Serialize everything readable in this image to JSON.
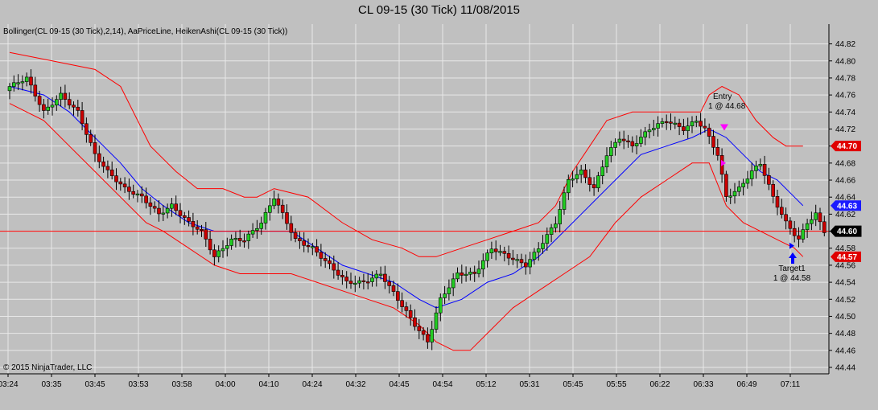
{
  "chart_data": {
    "type": "candlestick",
    "title": "CL 09-15 (30 Tick)  11/08/2015",
    "indicator_caption": "Bollinger(CL 09-15 (30 Tick),2,14), AaPriceLine, HeikenAshi(CL 09-15 (30 Tick))",
    "copyright": "© 2015 NinjaTrader, LLC",
    "ylim": [
      44.44,
      44.83
    ],
    "y_ticks": [
      "44.82",
      "44.80",
      "44.78",
      "44.76",
      "44.74",
      "44.72",
      "44.70",
      "44.68",
      "44.66",
      "44.64",
      "44.62",
      "44.60",
      "44.58",
      "44.56",
      "44.54",
      "44.52",
      "44.50",
      "44.48",
      "44.46",
      "44.44"
    ],
    "x_ticks": [
      "03:24",
      "03:35",
      "03:45",
      "03:53",
      "03:58",
      "04:00",
      "04:10",
      "04:24",
      "04:32",
      "04:45",
      "04:54",
      "05:12",
      "05:31",
      "05:45",
      "05:55",
      "06:22",
      "06:33",
      "06:49",
      "07:11"
    ],
    "price_line": 44.6,
    "price_tags": [
      {
        "label": "44.70",
        "value": 44.7,
        "color": "#e00000"
      },
      {
        "label": "44.63",
        "value": 44.63,
        "color": "#1a1aff"
      },
      {
        "label": "44.60",
        "value": 44.6,
        "color": "#000000"
      },
      {
        "label": "44.57",
        "value": 44.57,
        "color": "#e00000"
      }
    ],
    "annotations": [
      {
        "name": "entry",
        "line1": "Entry",
        "line2": "1 @ 44.68"
      },
      {
        "name": "target",
        "line1": "Target1",
        "line2": "1 @ 44.58"
      }
    ],
    "colors": {
      "bullish": "#22cc22",
      "bearish": "#cc0000",
      "upper_band": "#ff0000",
      "lower_band": "#ff0000",
      "middle_band": "#0000ff",
      "price_line": "#ff0000",
      "entry_marker": "#ff00ff",
      "target_marker": "#0000ff",
      "grid": "#e8e8e8"
    },
    "close_path": [
      [
        0,
        44.77
      ],
      [
        4,
        44.78
      ],
      [
        8,
        44.74
      ],
      [
        12,
        44.76
      ],
      [
        16,
        44.74
      ],
      [
        20,
        44.69
      ],
      [
        23,
        44.67
      ],
      [
        27,
        44.65
      ],
      [
        31,
        44.64
      ],
      [
        35,
        44.62
      ],
      [
        38,
        44.63
      ],
      [
        42,
        44.61
      ],
      [
        45,
        44.6
      ],
      [
        48,
        44.57
      ],
      [
        52,
        44.59
      ],
      [
        55,
        44.59
      ],
      [
        59,
        44.61
      ],
      [
        62,
        44.64
      ],
      [
        64,
        44.62
      ],
      [
        67,
        44.59
      ],
      [
        71,
        44.58
      ],
      [
        75,
        44.56
      ],
      [
        79,
        44.54
      ],
      [
        83,
        44.54
      ],
      [
        87,
        44.55
      ],
      [
        91,
        44.52
      ],
      [
        95,
        44.49
      ],
      [
        98,
        44.47
      ],
      [
        101,
        44.52
      ],
      [
        105,
        44.55
      ],
      [
        109,
        44.55
      ],
      [
        113,
        44.58
      ],
      [
        117,
        44.57
      ],
      [
        121,
        44.56
      ],
      [
        124,
        44.58
      ],
      [
        128,
        44.61
      ],
      [
        131,
        44.66
      ],
      [
        134,
        44.67
      ],
      [
        137,
        44.65
      ],
      [
        140,
        44.69
      ],
      [
        143,
        44.71
      ],
      [
        146,
        44.7
      ],
      [
        150,
        44.72
      ],
      [
        154,
        44.73
      ],
      [
        158,
        44.72
      ],
      [
        161,
        44.73
      ],
      [
        163,
        44.72
      ],
      [
        166,
        44.69
      ],
      [
        168,
        44.64
      ],
      [
        171,
        44.65
      ],
      [
        174,
        44.67
      ],
      [
        176,
        44.68
      ],
      [
        179,
        44.64
      ],
      [
        182,
        44.61
      ],
      [
        185,
        44.59
      ],
      [
        187,
        44.61
      ],
      [
        189,
        44.62
      ],
      [
        191,
        44.6
      ]
    ],
    "bands_upper": [
      [
        0,
        44.81
      ],
      [
        10,
        44.8
      ],
      [
        20,
        44.79
      ],
      [
        26,
        44.77
      ],
      [
        30,
        44.73
      ],
      [
        33,
        44.7
      ],
      [
        39,
        44.67
      ],
      [
        44,
        44.65
      ],
      [
        50,
        44.65
      ],
      [
        55,
        44.64
      ],
      [
        58,
        44.64
      ],
      [
        62,
        44.65
      ],
      [
        70,
        44.64
      ],
      [
        78,
        44.61
      ],
      [
        85,
        44.59
      ],
      [
        92,
        44.58
      ],
      [
        96,
        44.57
      ],
      [
        100,
        44.57
      ],
      [
        106,
        44.58
      ],
      [
        112,
        44.59
      ],
      [
        118,
        44.6
      ],
      [
        124,
        44.61
      ],
      [
        128,
        44.63
      ],
      [
        132,
        44.67
      ],
      [
        136,
        44.7
      ],
      [
        140,
        44.73
      ],
      [
        146,
        44.74
      ],
      [
        152,
        44.74
      ],
      [
        158,
        44.74
      ],
      [
        162,
        44.74
      ],
      [
        164,
        44.76
      ],
      [
        167,
        44.77
      ],
      [
        171,
        44.76
      ],
      [
        175,
        44.73
      ],
      [
        179,
        44.71
      ],
      [
        182,
        44.7
      ],
      [
        186,
        44.7
      ]
    ],
    "bands_middle": [
      [
        0,
        44.77
      ],
      [
        8,
        44.76
      ],
      [
        14,
        44.74
      ],
      [
        20,
        44.71
      ],
      [
        26,
        44.68
      ],
      [
        31,
        44.65
      ],
      [
        36,
        44.63
      ],
      [
        42,
        44.61
      ],
      [
        48,
        44.6
      ],
      [
        54,
        44.6
      ],
      [
        60,
        44.6
      ],
      [
        66,
        44.6
      ],
      [
        72,
        44.58
      ],
      [
        78,
        44.56
      ],
      [
        84,
        44.55
      ],
      [
        90,
        44.54
      ],
      [
        96,
        44.52
      ],
      [
        100,
        44.51
      ],
      [
        106,
        44.52
      ],
      [
        112,
        44.54
      ],
      [
        118,
        44.55
      ],
      [
        124,
        44.57
      ],
      [
        130,
        44.6
      ],
      [
        136,
        44.63
      ],
      [
        142,
        44.66
      ],
      [
        148,
        44.69
      ],
      [
        154,
        44.7
      ],
      [
        160,
        44.71
      ],
      [
        164,
        44.72
      ],
      [
        168,
        44.71
      ],
      [
        172,
        44.69
      ],
      [
        176,
        44.67
      ],
      [
        180,
        44.66
      ],
      [
        184,
        44.64
      ],
      [
        186,
        44.63
      ]
    ],
    "bands_lower": [
      [
        0,
        44.75
      ],
      [
        8,
        44.73
      ],
      [
        14,
        44.7
      ],
      [
        20,
        44.67
      ],
      [
        26,
        44.64
      ],
      [
        32,
        44.61
      ],
      [
        36,
        44.6
      ],
      [
        42,
        44.58
      ],
      [
        48,
        44.56
      ],
      [
        54,
        44.55
      ],
      [
        60,
        44.55
      ],
      [
        66,
        44.55
      ],
      [
        72,
        44.54
      ],
      [
        78,
        44.53
      ],
      [
        84,
        44.52
      ],
      [
        90,
        44.51
      ],
      [
        96,
        44.49
      ],
      [
        100,
        44.47
      ],
      [
        104,
        44.46
      ],
      [
        108,
        44.46
      ],
      [
        112,
        44.48
      ],
      [
        118,
        44.51
      ],
      [
        124,
        44.53
      ],
      [
        130,
        44.55
      ],
      [
        136,
        44.57
      ],
      [
        142,
        44.61
      ],
      [
        148,
        44.64
      ],
      [
        154,
        44.66
      ],
      [
        160,
        44.68
      ],
      [
        164,
        44.68
      ],
      [
        168,
        44.63
      ],
      [
        172,
        44.61
      ],
      [
        176,
        44.6
      ],
      [
        180,
        44.59
      ],
      [
        184,
        44.58
      ],
      [
        186,
        44.57
      ]
    ]
  }
}
